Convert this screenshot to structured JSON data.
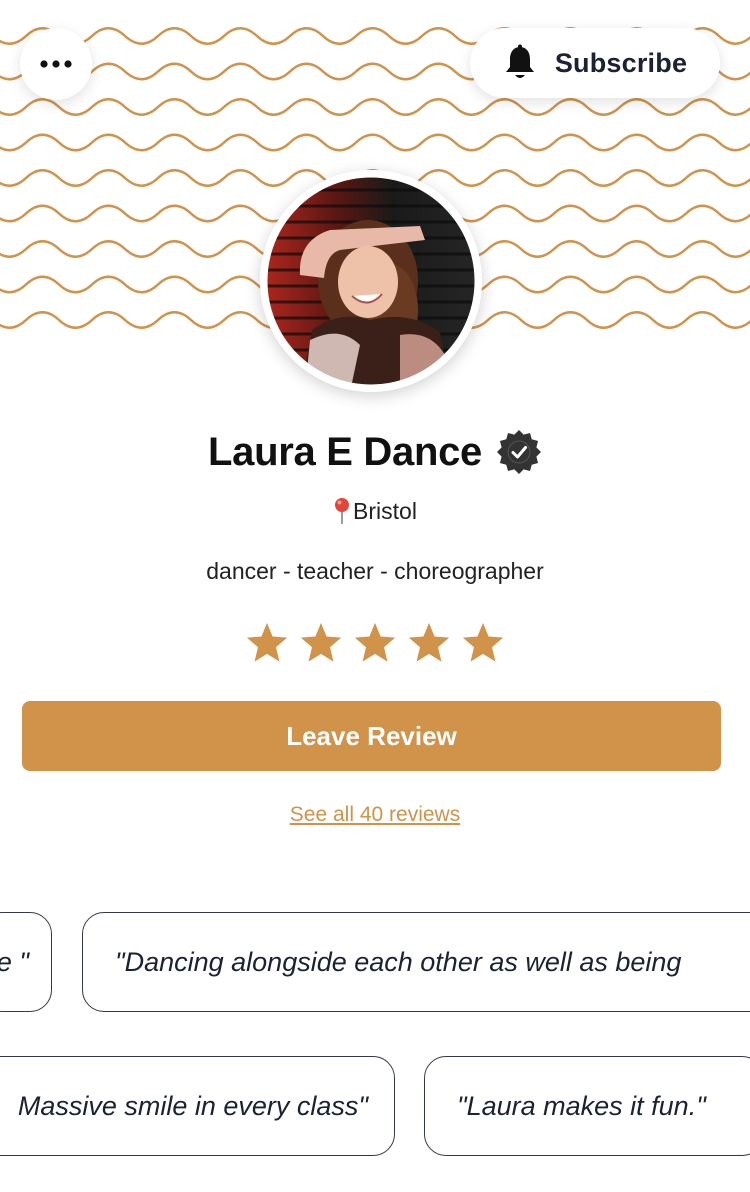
{
  "header": {
    "more_icon": "more-horizontal-icon",
    "subscribe_icon": "bell-icon",
    "subscribe_label": "Subscribe"
  },
  "profile": {
    "name": "Laura E Dance",
    "verified_icon": "verified-badge-icon",
    "location_icon": "map-pin-icon",
    "location": "Bristol",
    "tagline": "dancer - teacher - choreographer",
    "rating_stars": 5,
    "rating_max": 5
  },
  "actions": {
    "leave_review_label": "Leave Review",
    "see_all_label": "See all 40 reviews"
  },
  "reviews": [
    {
      "text": "e \""
    },
    {
      "text": "\"Dancing alongside each other as well as being"
    },
    {
      "text": "Massive smile in every class\""
    },
    {
      "text": "\"Laura makes it fun.\""
    }
  ],
  "colors": {
    "accent": "#d1924a",
    "wave": "#d1924a",
    "text": "#111111",
    "chip_text": "#1a2233"
  }
}
